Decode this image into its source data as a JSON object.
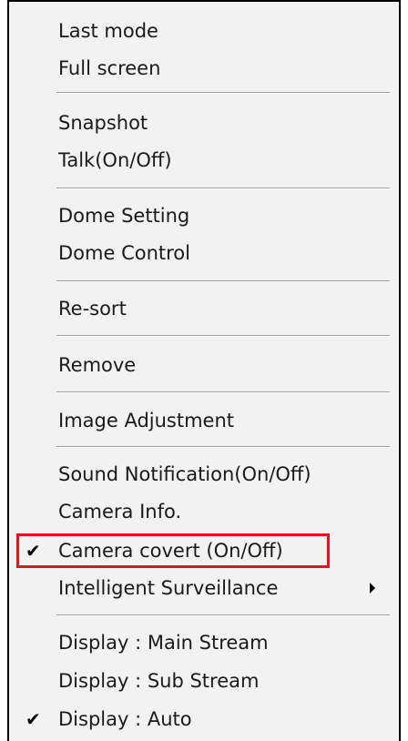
{
  "menu": {
    "groups": [
      {
        "items": [
          {
            "label": "Last mode"
          },
          {
            "label": "Full screen"
          }
        ]
      },
      {
        "items": [
          {
            "label": "Snapshot"
          },
          {
            "label": "Talk(On/Off)"
          }
        ]
      },
      {
        "items": [
          {
            "label": "Dome Setting"
          },
          {
            "label": "Dome Control"
          }
        ]
      },
      {
        "items": [
          {
            "label": "Re-sort"
          }
        ]
      },
      {
        "items": [
          {
            "label": "Remove"
          }
        ]
      },
      {
        "items": [
          {
            "label": "Image Adjustment"
          }
        ]
      },
      {
        "items": [
          {
            "label": "Sound Notification(On/Off)"
          },
          {
            "label": "Camera Info."
          },
          {
            "label": "Camera covert (On/Off)",
            "checked": true,
            "highlighted": true
          },
          {
            "label": "Intelligent Surveillance",
            "submenu": true
          }
        ]
      },
      {
        "items": [
          {
            "label": "Display : Main Stream"
          },
          {
            "label": "Display : Sub Stream"
          },
          {
            "label": "Display : Auto",
            "checked": true
          }
        ]
      }
    ],
    "check_glyph": "✔",
    "highlight_color": "#e0141e"
  }
}
